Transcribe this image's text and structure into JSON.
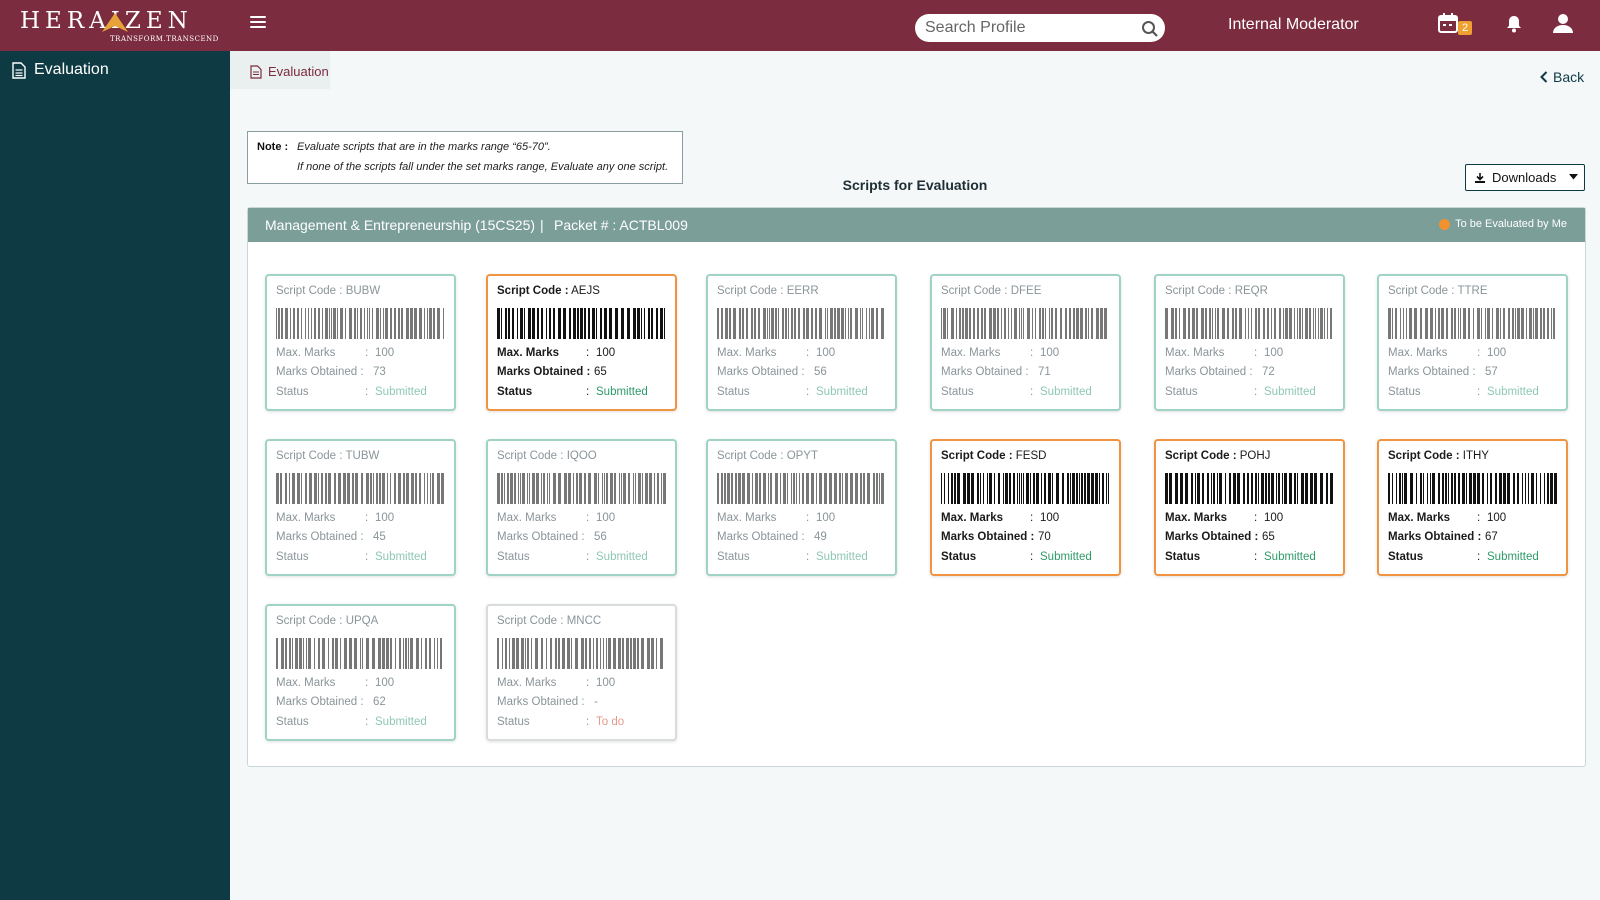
{
  "header": {
    "brand": "HERAIZEN",
    "tagline": "TRANSFORM.TRANSCEND",
    "search_placeholder": "Search Profile",
    "role": "Internal Moderator",
    "calendar_badge": "2"
  },
  "sidebar": {
    "items": [
      {
        "label": "Evaluation"
      }
    ]
  },
  "breadcrumb": {
    "label": "Evaluation"
  },
  "back_label": "Back",
  "note": {
    "label": "Note :",
    "line1": "Evaluate scripts that are in the marks range “65-70”.",
    "line2": "If none of the scripts fall under the set marks range, Evaluate any one script."
  },
  "section_title": "Scripts for Evaluation",
  "downloads_label": "Downloads",
  "panel": {
    "subject": "Management & Entrepreneurship (15CS25)",
    "separator": "|",
    "packet": "Packet # : ACTBL009",
    "legend": "To be Evaluated by Me",
    "legend_color": "#f0922e"
  },
  "labels": {
    "script_code": "Script Code :",
    "max_marks": "Max. Marks",
    "marks_obtained": "Marks Obtained :",
    "status": "Status",
    "colon": ":"
  },
  "cards": [
    {
      "code": "BUBW",
      "max": "100",
      "obtained": "73",
      "status": "Submitted",
      "state": "normal"
    },
    {
      "code": "AEJS",
      "max": "100",
      "obtained": "65",
      "status": "Submitted",
      "state": "highlight"
    },
    {
      "code": "EERR",
      "max": "100",
      "obtained": "56",
      "status": "Submitted",
      "state": "normal"
    },
    {
      "code": "DFEE",
      "max": "100",
      "obtained": "71",
      "status": "Submitted",
      "state": "normal"
    },
    {
      "code": "REQR",
      "max": "100",
      "obtained": "72",
      "status": "Submitted",
      "state": "normal"
    },
    {
      "code": "TTRE",
      "max": "100",
      "obtained": "57",
      "status": "Submitted",
      "state": "normal"
    },
    {
      "code": "TUBW",
      "max": "100",
      "obtained": "45",
      "status": "Submitted",
      "state": "normal"
    },
    {
      "code": "IQOO",
      "max": "100",
      "obtained": "56",
      "status": "Submitted",
      "state": "normal"
    },
    {
      "code": "OPYT",
      "max": "100",
      "obtained": "49",
      "status": "Submitted",
      "state": "normal"
    },
    {
      "code": "FESD",
      "max": "100",
      "obtained": "70",
      "status": "Submitted",
      "state": "highlight"
    },
    {
      "code": "POHJ",
      "max": "100",
      "obtained": "65",
      "status": "Submitted",
      "state": "highlight"
    },
    {
      "code": "ITHY",
      "max": "100",
      "obtained": "67",
      "status": "Submitted",
      "state": "highlight"
    },
    {
      "code": "UPQA",
      "max": "100",
      "obtained": "62",
      "status": "Submitted",
      "state": "normal"
    },
    {
      "code": "MNCC",
      "max": "100",
      "obtained": "-",
      "status": "To do",
      "state": "todo"
    }
  ]
}
